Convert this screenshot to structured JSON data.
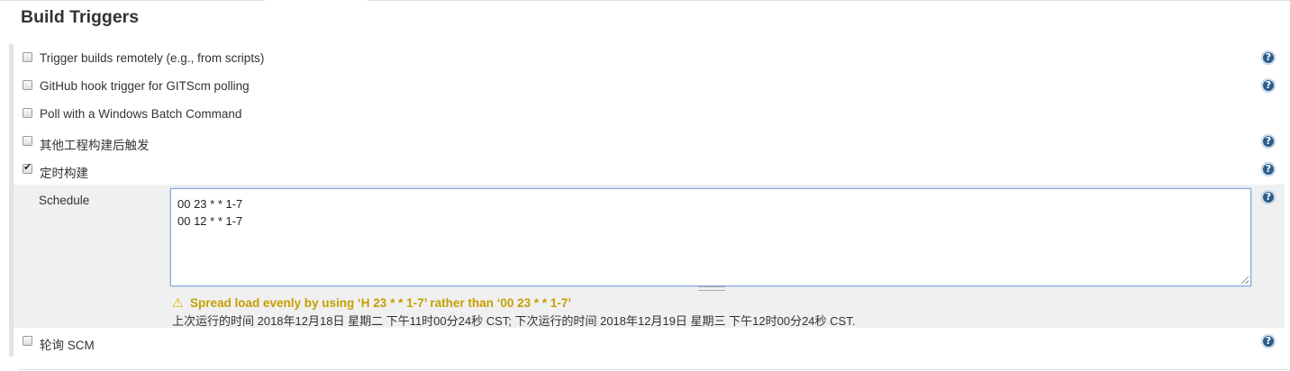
{
  "section": {
    "title": "Build Triggers"
  },
  "triggers": [
    {
      "label": "Trigger builds remotely (e.g., from scripts)",
      "checked": false,
      "has_help": true
    },
    {
      "label": "GitHub hook trigger for GITScm polling",
      "checked": false,
      "has_help": true
    },
    {
      "label": "Poll with a Windows Batch Command",
      "checked": false,
      "has_help": false
    },
    {
      "label": "其他工程构建后触发",
      "checked": false,
      "has_help": true
    },
    {
      "label": "定时构建",
      "checked": true,
      "has_help": true
    }
  ],
  "schedule": {
    "label": "Schedule",
    "lines": [
      "00 23 * * 1-7",
      "00 12 * * 1-7"
    ],
    "warning": "Spread load evenly by using ‘H 23 * * 1-7’ rather than ‘00 23 * * 1-7’",
    "next_run": "上次运行的时间 2018年12月18日 星期二 下午11时00分24秒 CST; 下次运行的时间 2018年12月19日 星期三 下午12时00分24秒 CST."
  },
  "last_trigger": {
    "label": "轮询 SCM",
    "checked": false,
    "has_help": true
  },
  "help_icon_glyph": "?",
  "warning_icon_glyph": "⚠",
  "colors": {
    "help_icon": "#2c5d8a",
    "warning_text": "#c4a000",
    "schedule_panel": "#f0f0f0"
  }
}
